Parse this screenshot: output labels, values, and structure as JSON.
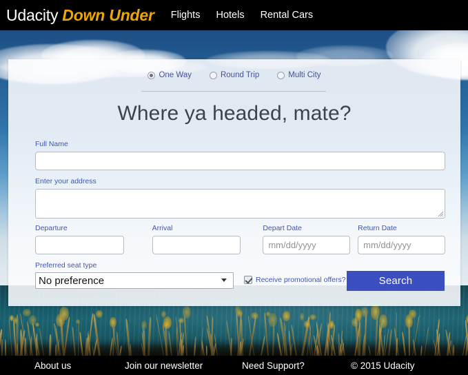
{
  "header": {
    "brand_primary": "Udacity",
    "brand_secondary": "Down Under",
    "nav": [
      {
        "label": "Flights"
      },
      {
        "label": "Hotels"
      },
      {
        "label": "Rental Cars"
      }
    ]
  },
  "form": {
    "trip_types": [
      {
        "label": "One Way",
        "selected": true
      },
      {
        "label": "Round Trip",
        "selected": false
      },
      {
        "label": "Multi City",
        "selected": false
      }
    ],
    "headline": "Where ya headed, mate?",
    "fields": {
      "full_name": {
        "label": "Full Name",
        "value": "",
        "placeholder": ""
      },
      "address": {
        "label": "Enter your address",
        "value": "",
        "placeholder": ""
      },
      "departure": {
        "label": "Departure",
        "value": "",
        "placeholder": ""
      },
      "arrival": {
        "label": "Arrival",
        "value": "",
        "placeholder": ""
      },
      "depart_date": {
        "label": "Depart Date",
        "value": "",
        "placeholder": "mm/dd/yyyy"
      },
      "return_date": {
        "label": "Return Date",
        "value": "",
        "placeholder": "mm/dd/yyyy"
      }
    },
    "seat": {
      "label": "Preferred seat type",
      "selected": "No preference",
      "options": [
        "No preference"
      ]
    },
    "promo": {
      "label": "Receive promotional offers?",
      "checked": true
    },
    "search_button": "Search"
  },
  "footer": {
    "links": [
      {
        "label": "About us"
      },
      {
        "label": "Join our newsletter"
      },
      {
        "label": "Need Support?"
      },
      {
        "label": "© 2015 Udacity"
      }
    ]
  },
  "colors": {
    "brand_accent": "#eda508",
    "label_blue": "#3d56b2",
    "button_blue": "#3c4fc0",
    "header_black": "#000000",
    "heading_gray": "#3c4349"
  }
}
